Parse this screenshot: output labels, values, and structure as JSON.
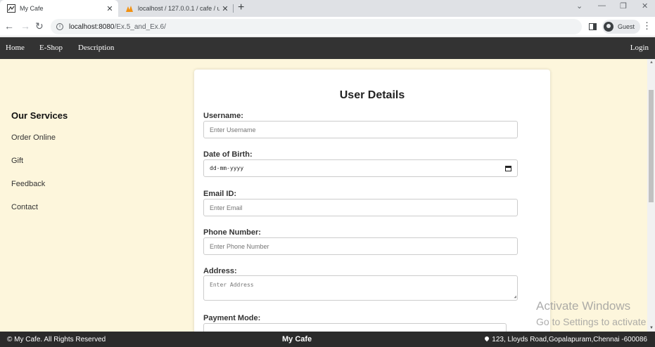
{
  "browser": {
    "tabs": [
      {
        "title": "My Cafe",
        "active": true
      },
      {
        "title": "localhost / 127.0.0.1 / cafe / user",
        "active": false
      }
    ],
    "url_host": "localhost:8080",
    "url_path": "/Ex.5_and_Ex.6/",
    "profile_label": "Guest"
  },
  "nav": {
    "links": [
      "Home",
      "E-Shop",
      "Description"
    ],
    "login": "Login"
  },
  "services": {
    "title": "Our Services",
    "items": [
      "Order Online",
      "Gift",
      "Feedback",
      "Contact"
    ]
  },
  "form": {
    "title": "User Details",
    "username_label": "Username:",
    "username_placeholder": "Enter Username",
    "dob_label": "Date of Birth:",
    "dob_value": "dd-mm-yyyy",
    "email_label": "Email ID:",
    "email_placeholder": "Enter Email",
    "phone_label": "Phone Number:",
    "phone_placeholder": "Enter Phone Number",
    "address_label": "Address:",
    "address_placeholder": "Enter Address",
    "payment_label": "Payment Mode:"
  },
  "watermark": {
    "line1": "Activate Windows",
    "line2": "Go to Settings to activate"
  },
  "footer": {
    "copyright": "© My Cafe. All Rights Reserved",
    "brand": "My Cafe",
    "address": "123, Lloyds Road,Gopalapuram,Chennai -600086"
  },
  "colors": {
    "page_bg": "#fdf6dc",
    "navbar_bg": "#333333",
    "footer_bg": "#2b2b2b"
  }
}
